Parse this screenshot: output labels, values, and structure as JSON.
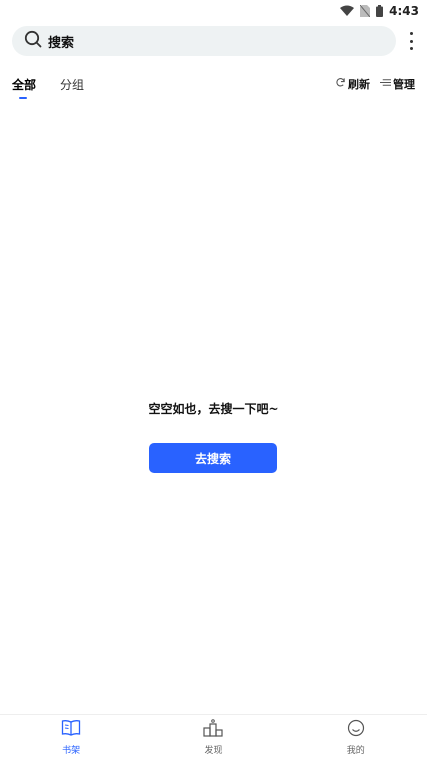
{
  "status_bar": {
    "time": "4:43"
  },
  "search": {
    "placeholder": "搜索"
  },
  "tabs": [
    {
      "label": "全部",
      "active": true
    },
    {
      "label": "分组",
      "active": false
    }
  ],
  "actions": {
    "refresh": "刷新",
    "manage": "管理"
  },
  "empty_state": {
    "message": "空空如也，去搜一下吧~",
    "button_label": "去搜索"
  },
  "bottom_nav": [
    {
      "label": "书架",
      "icon": "bookshelf-icon",
      "active": true
    },
    {
      "label": "发现",
      "icon": "discover-icon",
      "active": false
    },
    {
      "label": "我的",
      "icon": "profile-icon",
      "active": false
    }
  ],
  "colors": {
    "accent": "#2962ff",
    "search_bg": "#eef2f3"
  }
}
